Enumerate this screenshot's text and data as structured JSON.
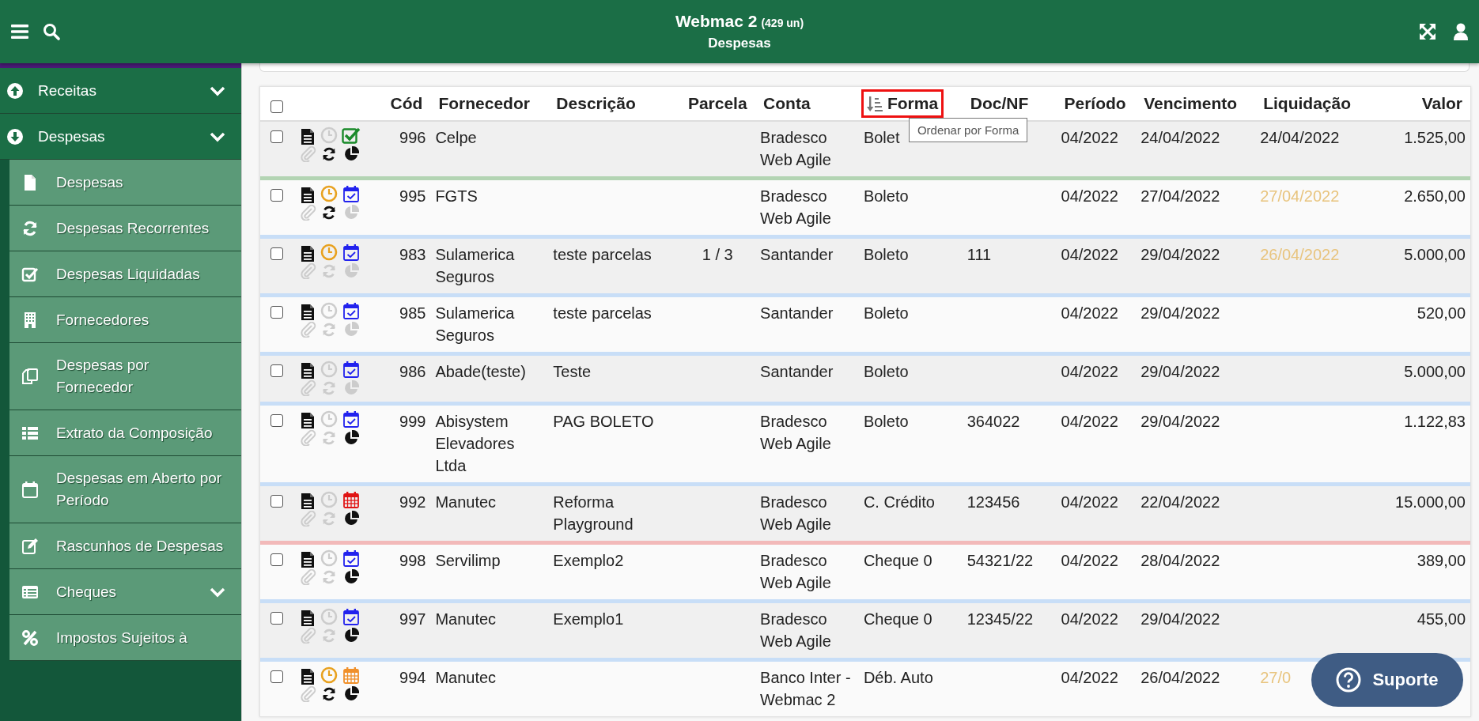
{
  "header": {
    "title": "Webmac 2",
    "count": "(429 un)",
    "subtitle": "Despesas"
  },
  "sidebar": {
    "items": [
      {
        "label": "Receitas",
        "kind": "group"
      },
      {
        "label": "Despesas",
        "kind": "group"
      },
      {
        "label": "Despesas",
        "kind": "item"
      },
      {
        "label": "Despesas Recorrentes",
        "kind": "item"
      },
      {
        "label": "Despesas Liquidadas",
        "kind": "item"
      },
      {
        "label": "Fornecedores",
        "kind": "item"
      },
      {
        "label": "Despesas por Fornecedor",
        "kind": "item"
      },
      {
        "label": "Extrato da Composição",
        "kind": "item"
      },
      {
        "label": "Despesas em Aberto por Período",
        "kind": "item"
      },
      {
        "label": "Rascunhos de Despesas",
        "kind": "item"
      },
      {
        "label": "Cheques",
        "kind": "submenu"
      },
      {
        "label": "Impostos Sujeitos à",
        "kind": "item"
      }
    ]
  },
  "table": {
    "columns": [
      {
        "label": "Cód"
      },
      {
        "label": "Fornecedor"
      },
      {
        "label": "Descrição"
      },
      {
        "label": "Parcela"
      },
      {
        "label": "Conta"
      },
      {
        "label": "Forma",
        "sorted": true,
        "highlighted": true,
        "tooltip": "Ordenar por Forma"
      },
      {
        "label": "Doc/NF"
      },
      {
        "label": "Período"
      },
      {
        "label": "Vencimento"
      },
      {
        "label": "Liquidação"
      },
      {
        "label": "Valor"
      }
    ],
    "all_checked": false,
    "rows": [
      {
        "checked": false,
        "clock": false,
        "calendar": {
          "kind": "paid"
        },
        "attachment": false,
        "recurring": true,
        "split": true,
        "color": "#b3d4b3",
        "liquidacao_pending": false,
        "cells": [
          "996",
          "Celpe",
          "",
          "",
          "Bradesco Web Agile",
          "Bolet",
          "",
          "04/2022",
          "24/04/2022",
          "24/04/2022",
          "1.525,00"
        ]
      },
      {
        "checked": false,
        "clock": true,
        "calendar": {
          "kind": "scheduled"
        },
        "attachment": false,
        "recurring": true,
        "split": false,
        "color": "#c8def7",
        "liquidacao_pending": true,
        "cells": [
          "995",
          "FGTS",
          "",
          "",
          "Bradesco Web Agile",
          "Boleto",
          "",
          "04/2022",
          "27/04/2022",
          "27/04/2022",
          "2.650,00"
        ]
      },
      {
        "checked": false,
        "clock": true,
        "calendar": {
          "kind": "scheduled"
        },
        "attachment": false,
        "recurring": false,
        "split": false,
        "color": "#c8def7",
        "liquidacao_pending": true,
        "cells": [
          "983",
          "Sulamerica Seguros",
          "teste parcelas",
          "1 / 3",
          "Santander",
          "Boleto",
          "111",
          "04/2022",
          "29/04/2022",
          "26/04/2022",
          "5.000,00"
        ]
      },
      {
        "checked": false,
        "clock": false,
        "calendar": {
          "kind": "scheduled"
        },
        "attachment": false,
        "recurring": false,
        "split": false,
        "color": "#c8def7",
        "cells": [
          "985",
          "Sulamerica Seguros",
          "teste parcelas",
          "",
          "Santander",
          "Boleto",
          "",
          "04/2022",
          "29/04/2022",
          "",
          "520,00"
        ]
      },
      {
        "checked": false,
        "clock": false,
        "calendar": {
          "kind": "scheduled"
        },
        "attachment": false,
        "recurring": false,
        "split": false,
        "color": "#c8def7",
        "cells": [
          "986",
          "Abade(teste)",
          "Teste",
          "",
          "Santander",
          "Boleto",
          "",
          "04/2022",
          "29/04/2022",
          "",
          "5.000,00"
        ]
      },
      {
        "checked": false,
        "clock": false,
        "calendar": {
          "kind": "scheduled"
        },
        "attachment": false,
        "recurring": false,
        "split": true,
        "color": "#c8def7",
        "cells": [
          "999",
          "Abisystem Elevadores Ltda",
          "PAG BOLETO",
          "",
          "Bradesco Web Agile",
          "Boleto",
          "364022",
          "04/2022",
          "29/04/2022",
          "",
          "1.122,83"
        ]
      },
      {
        "checked": false,
        "clock": false,
        "calendar": {
          "kind": "overdue"
        },
        "attachment": false,
        "recurring": false,
        "split": true,
        "color": "#f2b9b9",
        "cells": [
          "992",
          "Manutec",
          "Reforma Playground",
          "",
          "Bradesco Web Agile",
          "C. Crédito",
          "123456",
          "04/2022",
          "22/04/2022",
          "",
          "15.000,00"
        ]
      },
      {
        "checked": false,
        "clock": false,
        "calendar": {
          "kind": "scheduled"
        },
        "attachment": false,
        "recurring": false,
        "split": true,
        "color": "#c8def7",
        "cells": [
          "998",
          "Servilimp",
          "Exemplo2",
          "",
          "Bradesco Web Agile",
          "Cheque 0",
          "54321/22",
          "04/2022",
          "28/04/2022",
          "",
          "389,00"
        ]
      },
      {
        "checked": false,
        "clock": false,
        "calendar": {
          "kind": "scheduled"
        },
        "attachment": false,
        "recurring": false,
        "split": true,
        "color": "#c8def7",
        "cells": [
          "997",
          "Manutec",
          "Exemplo1",
          "",
          "Bradesco Web Agile",
          "Cheque 0",
          "12345/22",
          "04/2022",
          "29/04/2022",
          "",
          "455,00"
        ]
      },
      {
        "checked": false,
        "clock": true,
        "calendar": {
          "kind": "pending"
        },
        "attachment": false,
        "recurring": true,
        "split": true,
        "liquidacao_pending": true,
        "cells": [
          "994",
          "Manutec",
          "",
          "",
          "Banco Inter - Webmac 2",
          "Déb. Auto",
          "",
          "04/2022",
          "26/04/2022",
          "27/0",
          ""
        ]
      }
    ]
  },
  "support_button": {
    "label": "Suporte"
  }
}
